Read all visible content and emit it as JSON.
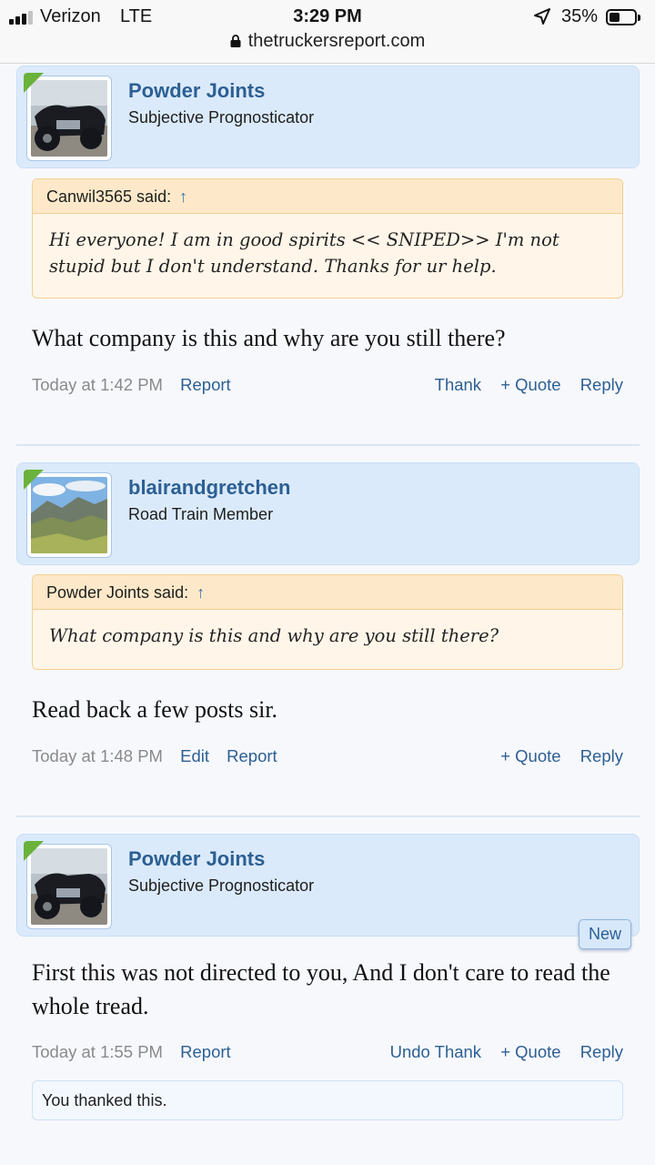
{
  "status_bar": {
    "carrier": "Verizon",
    "network": "LTE",
    "time": "3:29 PM",
    "battery": "35%"
  },
  "browser": {
    "url": "thetruckersreport.com"
  },
  "posts": [
    {
      "username": "Powder Joints",
      "user_title": "Subjective Prognosticator",
      "quote": {
        "author_line": "Canwil3565 said:",
        "text": "Hi everyone! I am in good spirits << SNIPED>> I'm not stupid but I don't understand. Thanks for ur help."
      },
      "message": "What company is this and why are you still there?",
      "timestamp": "Today at 1:42 PM",
      "left_actions": [
        "Report"
      ],
      "right_actions": [
        "Thank",
        "+ Quote",
        "Reply"
      ]
    },
    {
      "username": "blairandgretchen",
      "user_title": "Road Train Member",
      "quote": {
        "author_line": "Powder Joints said:",
        "text": "What company is this and why are you still there?"
      },
      "message": "Read back a few posts sir.",
      "timestamp": "Today at 1:48 PM",
      "left_actions": [
        "Edit",
        "Report"
      ],
      "right_actions": [
        "+ Quote",
        "Reply"
      ]
    },
    {
      "username": "Powder Joints",
      "user_title": "Subjective Prognosticator",
      "badge": "New",
      "message": "First this was not directed to you, And I don't care to read the whole tread.",
      "timestamp": "Today at 1:55 PM",
      "left_actions": [
        "Report"
      ],
      "right_actions": [
        "Undo Thank",
        "+ Quote",
        "Reply"
      ],
      "thanked_note": "You thanked this."
    }
  ],
  "icons": {
    "signal": "cellular-signal-icon",
    "location": "location-arrow-icon",
    "battery": "battery-icon",
    "lock": "lock-icon",
    "quote_link": "up-arrow-icon"
  },
  "colors": {
    "link": "#2c5f93",
    "userbox_bg": "#dbeafb",
    "quote_bg": "#fff6e9",
    "quote_head_bg": "#fde9c9",
    "staff_corner": "#6ab23c"
  }
}
